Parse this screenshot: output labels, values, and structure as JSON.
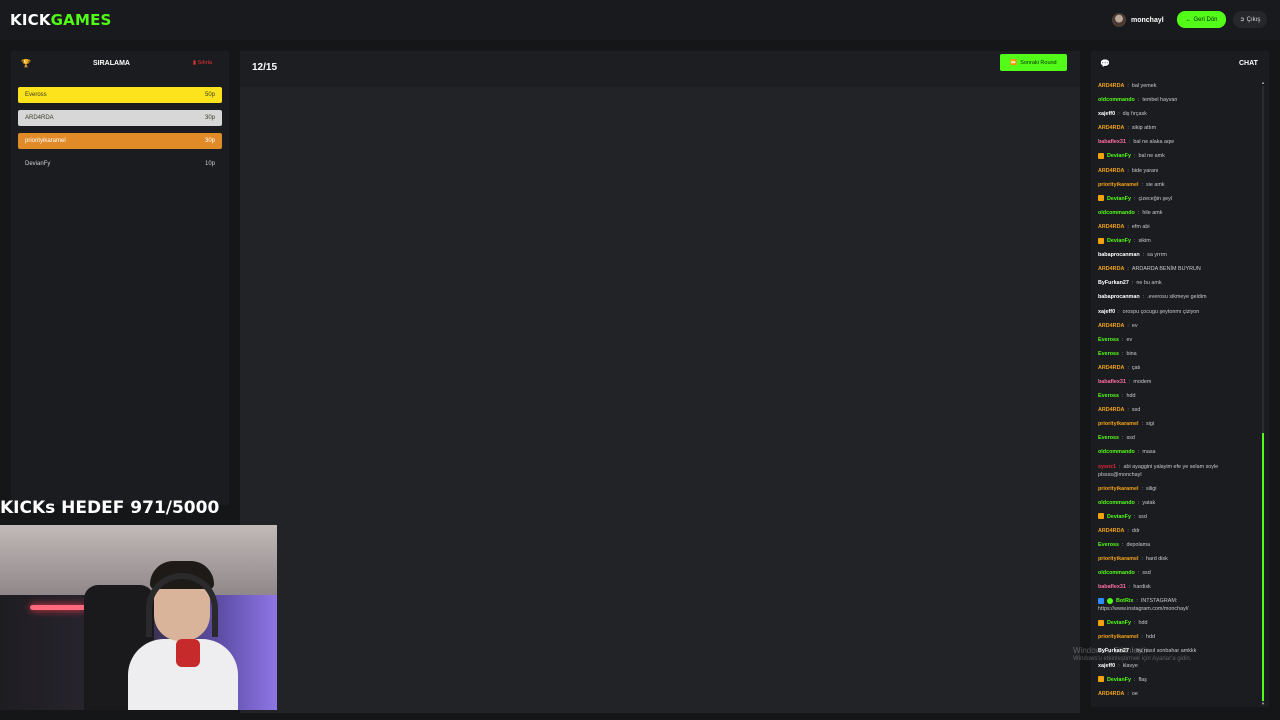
{
  "app": {
    "logo_part1": "KICK",
    "logo_part2": "GAMES",
    "accent": "#53fc18"
  },
  "header": {
    "username": "monchayl",
    "back_label": "Geri Dön",
    "exit_label": "Çıkış"
  },
  "ranking": {
    "title": "SIRALAMA",
    "reset_label": "Sıfırla",
    "rows": [
      {
        "name": "Eveross",
        "score": "50p",
        "color": "#fce31b"
      },
      {
        "name": "ARD4RDA",
        "score": "30p",
        "color": "#d7d7d7"
      },
      {
        "name": "priorityikaramel",
        "score": "30p",
        "color": "#e08a28"
      },
      {
        "name": "DevianFy",
        "score": "10p",
        "color": "none"
      }
    ]
  },
  "game": {
    "round": "12/15",
    "next_round_label": "Sonraki Round"
  },
  "chat": {
    "title": "CHAT",
    "messages": [
      {
        "user": "ARD4RDA",
        "color": "#f1a21b",
        "text": "bal yemek"
      },
      {
        "user": "oldcommando",
        "color": "#53fc18",
        "text": "tembel hayvan"
      },
      {
        "user": "xajeff0",
        "color": "#ffffff",
        "text": "diş fırçask"
      },
      {
        "user": "ARD4RDA",
        "color": "#f1a21b",
        "text": "sikip attım"
      },
      {
        "user": "babaflex31",
        "color": "#ff6fa0",
        "text": "bal ne alaka aqw"
      },
      {
        "user": "DevianFy",
        "color": "#53fc18",
        "badge": "gold",
        "text": "bal ne amk"
      },
      {
        "user": "ARD4RDA",
        "color": "#f1a21b",
        "text": "bide yaranı"
      },
      {
        "user": "priorityikaramel",
        "color": "#f1a21b",
        "text": "sie amk"
      },
      {
        "user": "DevianFy",
        "color": "#53fc18",
        "badge": "gold",
        "text": "çizeceğin şeyl"
      },
      {
        "user": "oldcommando",
        "color": "#53fc18",
        "text": "hile amk"
      },
      {
        "user": "ARD4RDA",
        "color": "#f1a21b",
        "text": "efm abi"
      },
      {
        "user": "DevianFy",
        "color": "#53fc18",
        "badge": "gold",
        "text": "sikim"
      },
      {
        "user": "babaprocanman",
        "color": "#ffffff",
        "text": "sa yrrrm"
      },
      {
        "user": "ARD4RDA",
        "color": "#f1a21b",
        "text": "ARDARDA BENİM BUYRUN"
      },
      {
        "user": "ByFurkan27",
        "color": "#ffffff",
        "text": "ne bu amk"
      },
      {
        "user": "babaprocanman",
        "color": "#ffffff",
        "text": ".everosu sikmeye geldim"
      },
      {
        "user": "xajeff0",
        "color": "#ffffff",
        "text": "orospu çocugu şeytonmı çiziyon"
      },
      {
        "user": "ARD4RDA",
        "color": "#f1a21b",
        "text": "ev"
      },
      {
        "user": "Eveross",
        "color": "#53fc18",
        "text": "ev"
      },
      {
        "user": "Eveross",
        "color": "#53fc18",
        "text": "bina"
      },
      {
        "user": "ARD4RDA",
        "color": "#f1a21b",
        "text": "çatı"
      },
      {
        "user": "babaflex31",
        "color": "#ff6fa0",
        "text": "modem"
      },
      {
        "user": "Eveross",
        "color": "#53fc18",
        "text": "hdd"
      },
      {
        "user": "ARD4RDA",
        "color": "#f1a21b",
        "text": "ssd"
      },
      {
        "user": "priorityikaramel",
        "color": "#f1a21b",
        "text": "sigi"
      },
      {
        "user": "Eveross",
        "color": "#53fc18",
        "text": "ssd"
      },
      {
        "user": "oldcommando",
        "color": "#53fc18",
        "text": "masa"
      },
      {
        "user": "sysnz1",
        "color": "#e0263a",
        "text": "abi ayaggini yalayim efe ye selam soyle plssss@monchayl",
        "wrap": true
      },
      {
        "user": "priorityikaramel",
        "color": "#f1a21b",
        "text": "siligi"
      },
      {
        "user": "oldcommando",
        "color": "#53fc18",
        "text": "yatak"
      },
      {
        "user": "DevianFy",
        "color": "#53fc18",
        "badge": "gold",
        "text": "ssd"
      },
      {
        "user": "ARD4RDA",
        "color": "#f1a21b",
        "text": "ddr"
      },
      {
        "user": "Eveross",
        "color": "#53fc18",
        "text": "depolama"
      },
      {
        "user": "priorityikaramel",
        "color": "#f1a21b",
        "text": "hard disk"
      },
      {
        "user": "oldcommando",
        "color": "#53fc18",
        "text": "ssd"
      },
      {
        "user": "babaflex31",
        "color": "#ff6fa0",
        "text": "hardisk"
      },
      {
        "user": "BotRix",
        "color": "#53fc18",
        "badge": "bot",
        "text": "INTSTAGRAM: https://www.instagram.com/monchayl/",
        "wrap": true
      },
      {
        "user": "DevianFy",
        "color": "#53fc18",
        "badge": "gold",
        "text": "hdd"
      },
      {
        "user": "priorityikaramel",
        "color": "#f1a21b",
        "text": "hdd"
      },
      {
        "user": "ByFurkan27",
        "color": "#ffffff",
        "text": "bu nasıl sonbahar amkkk"
      },
      {
        "user": "xajeff0",
        "color": "#ffffff",
        "text": "klavye"
      },
      {
        "user": "DevianFy",
        "color": "#53fc18",
        "badge": "gold",
        "text": "flaş"
      },
      {
        "user": "ARD4RDA",
        "color": "#f1a21b",
        "text": "oe"
      }
    ]
  },
  "overlay": {
    "goal_text": "KICKs HEDEF 971/5000",
    "goal_current": 971,
    "goal_total": 5000,
    "watermark_line1": "Windows'u Etkinleştir",
    "watermark_line2": "Windows'u etkinleştirmek için Ayarlar'a gidin."
  },
  "icons": {
    "ranking": "trophy-icon",
    "reset": "trash-icon",
    "chat": "chat-bubbles-icon",
    "back": "arrow-left-icon",
    "exit": "logout-icon",
    "next": "fast-forward-icon"
  }
}
